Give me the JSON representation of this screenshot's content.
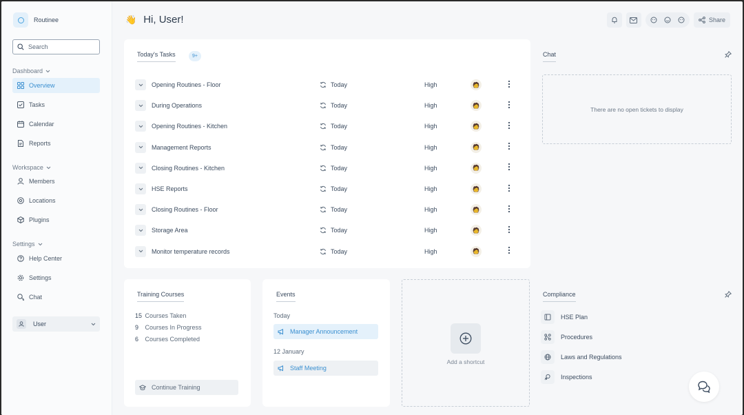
{
  "app": {
    "name": "Routinee",
    "colors": {
      "accent": "#3a8fd0",
      "accent_bg": "#e4f1fb",
      "text": "#3b4b5f"
    }
  },
  "sidebar": {
    "search": {
      "placeholder": "Search",
      "icon": "search-icon"
    },
    "sections": [
      {
        "label": "Dashboard",
        "items": [
          {
            "label": "Overview",
            "icon": "grid-icon",
            "active": true
          },
          {
            "label": "Tasks",
            "icon": "checkbox-icon"
          },
          {
            "label": "Calendar",
            "icon": "calendar-icon"
          },
          {
            "label": "Reports",
            "icon": "document-icon"
          }
        ]
      },
      {
        "label": "Workspace",
        "items": [
          {
            "label": "Members",
            "icon": "person-icon"
          },
          {
            "label": "Locations",
            "icon": "location-pin-icon"
          },
          {
            "label": "Plugins",
            "icon": "cube-icon"
          }
        ]
      },
      {
        "label": "Settings",
        "items": [
          {
            "label": "Help Center",
            "icon": "help-icon"
          },
          {
            "label": "Settings",
            "icon": "gear-icon"
          },
          {
            "label": "Chat",
            "icon": "chat-icon"
          }
        ]
      }
    ],
    "user": {
      "label": "User",
      "icon": "avatar-icon"
    }
  },
  "header": {
    "greeting_emoji": "👋",
    "greeting": "Hi, User!",
    "share_label": "Share",
    "actions": [
      "bell-icon",
      "mail-icon",
      "avatar-icon",
      "avatar-icon",
      "avatar-icon",
      "share-icon"
    ]
  },
  "tasks": {
    "tab_label": "Today's Tasks",
    "badge": "9+",
    "rows": [
      {
        "name": "Opening Routines - Floor",
        "due": "Today",
        "priority": "High",
        "avatar": "🧑"
      },
      {
        "name": "During Operations",
        "due": "Today",
        "priority": "High",
        "avatar": "🧑"
      },
      {
        "name": "Opening Routines - Kitchen",
        "due": "Today",
        "priority": "High",
        "avatar": "🧑"
      },
      {
        "name": "Management Reports",
        "due": "Today",
        "priority": "High",
        "avatar": "🧑"
      },
      {
        "name": "Closing Routines - Kitchen",
        "due": "Today",
        "priority": "High",
        "avatar": "🧑"
      },
      {
        "name": "HSE Reports",
        "due": "Today",
        "priority": "High",
        "avatar": "🧑"
      },
      {
        "name": "Closing Routines - Floor",
        "due": "Today",
        "priority": "High",
        "avatar": "🧑"
      },
      {
        "name": "Storage Area",
        "due": "Today",
        "priority": "High",
        "avatar": "🧑"
      },
      {
        "name": "Monitor temperature records",
        "due": "Today",
        "priority": "High",
        "avatar": "🧑"
      }
    ]
  },
  "chat": {
    "tab_label": "Chat",
    "empty_text": "There are no open tickets to display"
  },
  "training": {
    "tab_label": "Training Courses",
    "stats": [
      {
        "count": "15",
        "label": "Courses Taken"
      },
      {
        "count": "9",
        "label": "Courses In Progress"
      },
      {
        "count": "6",
        "label": "Courses Completed"
      }
    ],
    "continue_label": "Continue Training"
  },
  "events": {
    "tab_label": "Events",
    "groups": [
      {
        "day": "Today",
        "item": "Manager Announcement"
      },
      {
        "day": "12 January",
        "item": "Staff Meeting"
      }
    ]
  },
  "shortcut": {
    "label": "Add a shortcut"
  },
  "compliance": {
    "tab_label": "Compliance",
    "items": [
      {
        "label": "HSE Plan",
        "icon": "book-icon"
      },
      {
        "label": "Procedures",
        "icon": "flow-icon"
      },
      {
        "label": "Laws and Regulations",
        "icon": "globe-icon"
      },
      {
        "label": "Inspections",
        "icon": "inspection-icon"
      }
    ]
  }
}
